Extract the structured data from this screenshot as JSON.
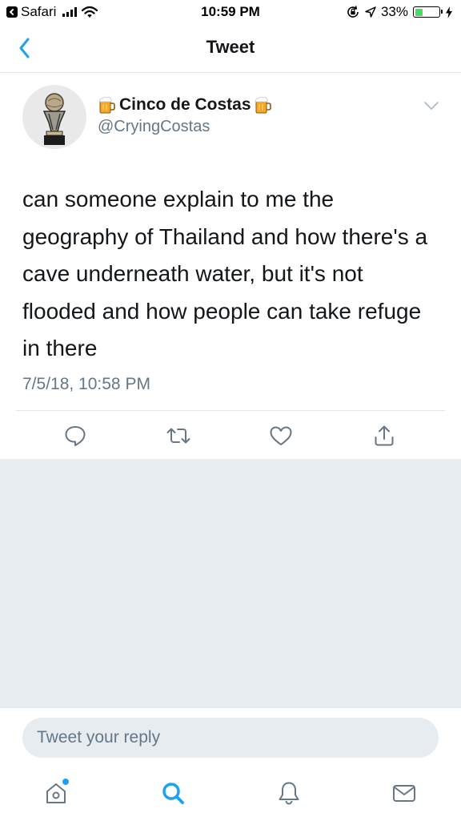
{
  "status_bar": {
    "back_app": "Safari",
    "time": "10:59 PM",
    "battery_percent": "33%",
    "battery_level": 0.33,
    "battery_color": "#4cd964"
  },
  "nav": {
    "title": "Tweet",
    "back_icon": "chevron-left-icon"
  },
  "tweet": {
    "display_name": "Cinco de Costas",
    "name_emoji": "beer-mug-icon",
    "handle": "@CryingCostas",
    "text": "can someone explain to me the geography of Thailand and how there's a cave underneath water, but it's not flooded and how people can take refuge in there",
    "timestamp": "7/5/18, 10:58 PM",
    "avatar": "trophy-icon",
    "actions": [
      "reply-icon",
      "retweet-icon",
      "like-icon",
      "share-icon"
    ]
  },
  "reply": {
    "placeholder": "Tweet your reply"
  },
  "tab_bar": {
    "tabs": [
      "home-icon",
      "search-icon",
      "notifications-icon",
      "messages-icon"
    ],
    "active_tab": "search-icon"
  },
  "colors": {
    "accent": "#1da1f2",
    "secondary_text": "#657786",
    "gray_background": "#e6ecf0",
    "divider": "#e1e8ed"
  }
}
